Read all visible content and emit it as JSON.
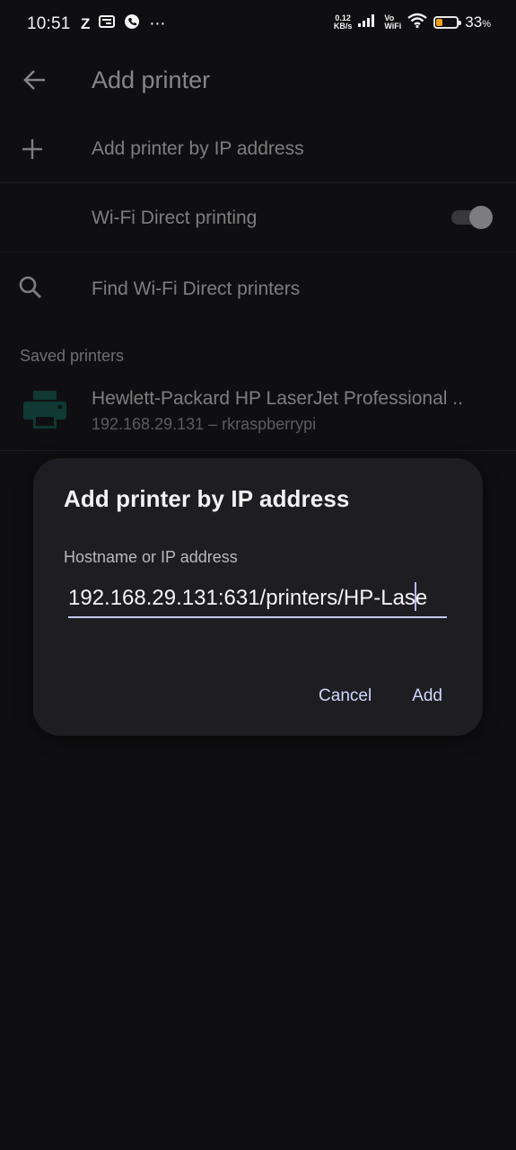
{
  "status_bar": {
    "time": "10:51",
    "left_icons": [
      "z-app-icon",
      "message-icon",
      "phone-app-icon",
      "more-dots-icon"
    ],
    "net_speed_value": "0.12",
    "net_speed_unit": "KB/s",
    "vowifi_line1": "Vo",
    "vowifi_line2": "WiFi",
    "battery_percent": "33",
    "battery_percent_sign": "%",
    "battery_level": 0.33,
    "battery_color": "#f0a020"
  },
  "app_bar": {
    "title": "Add printer"
  },
  "menu": {
    "add_by_ip": "Add printer by IP address",
    "wifi_direct": "Wi-Fi Direct printing",
    "find_wifi_direct": "Find Wi-Fi Direct printers"
  },
  "saved_printers": {
    "header": "Saved printers",
    "items": [
      {
        "name": "Hewlett-Packard HP LaserJet Professional ..",
        "detail": "192.168.29.131 – rkraspberrypi",
        "icon_color": "#0f5c4d"
      }
    ]
  },
  "dialog": {
    "title": "Add printer by IP address",
    "field_label": "Hostname or IP address",
    "field_value": "192.168.29.131:631/printers/HP-Lase",
    "cancel_label": "Cancel",
    "add_label": "Add",
    "accent_color": "#c8c8f0"
  }
}
